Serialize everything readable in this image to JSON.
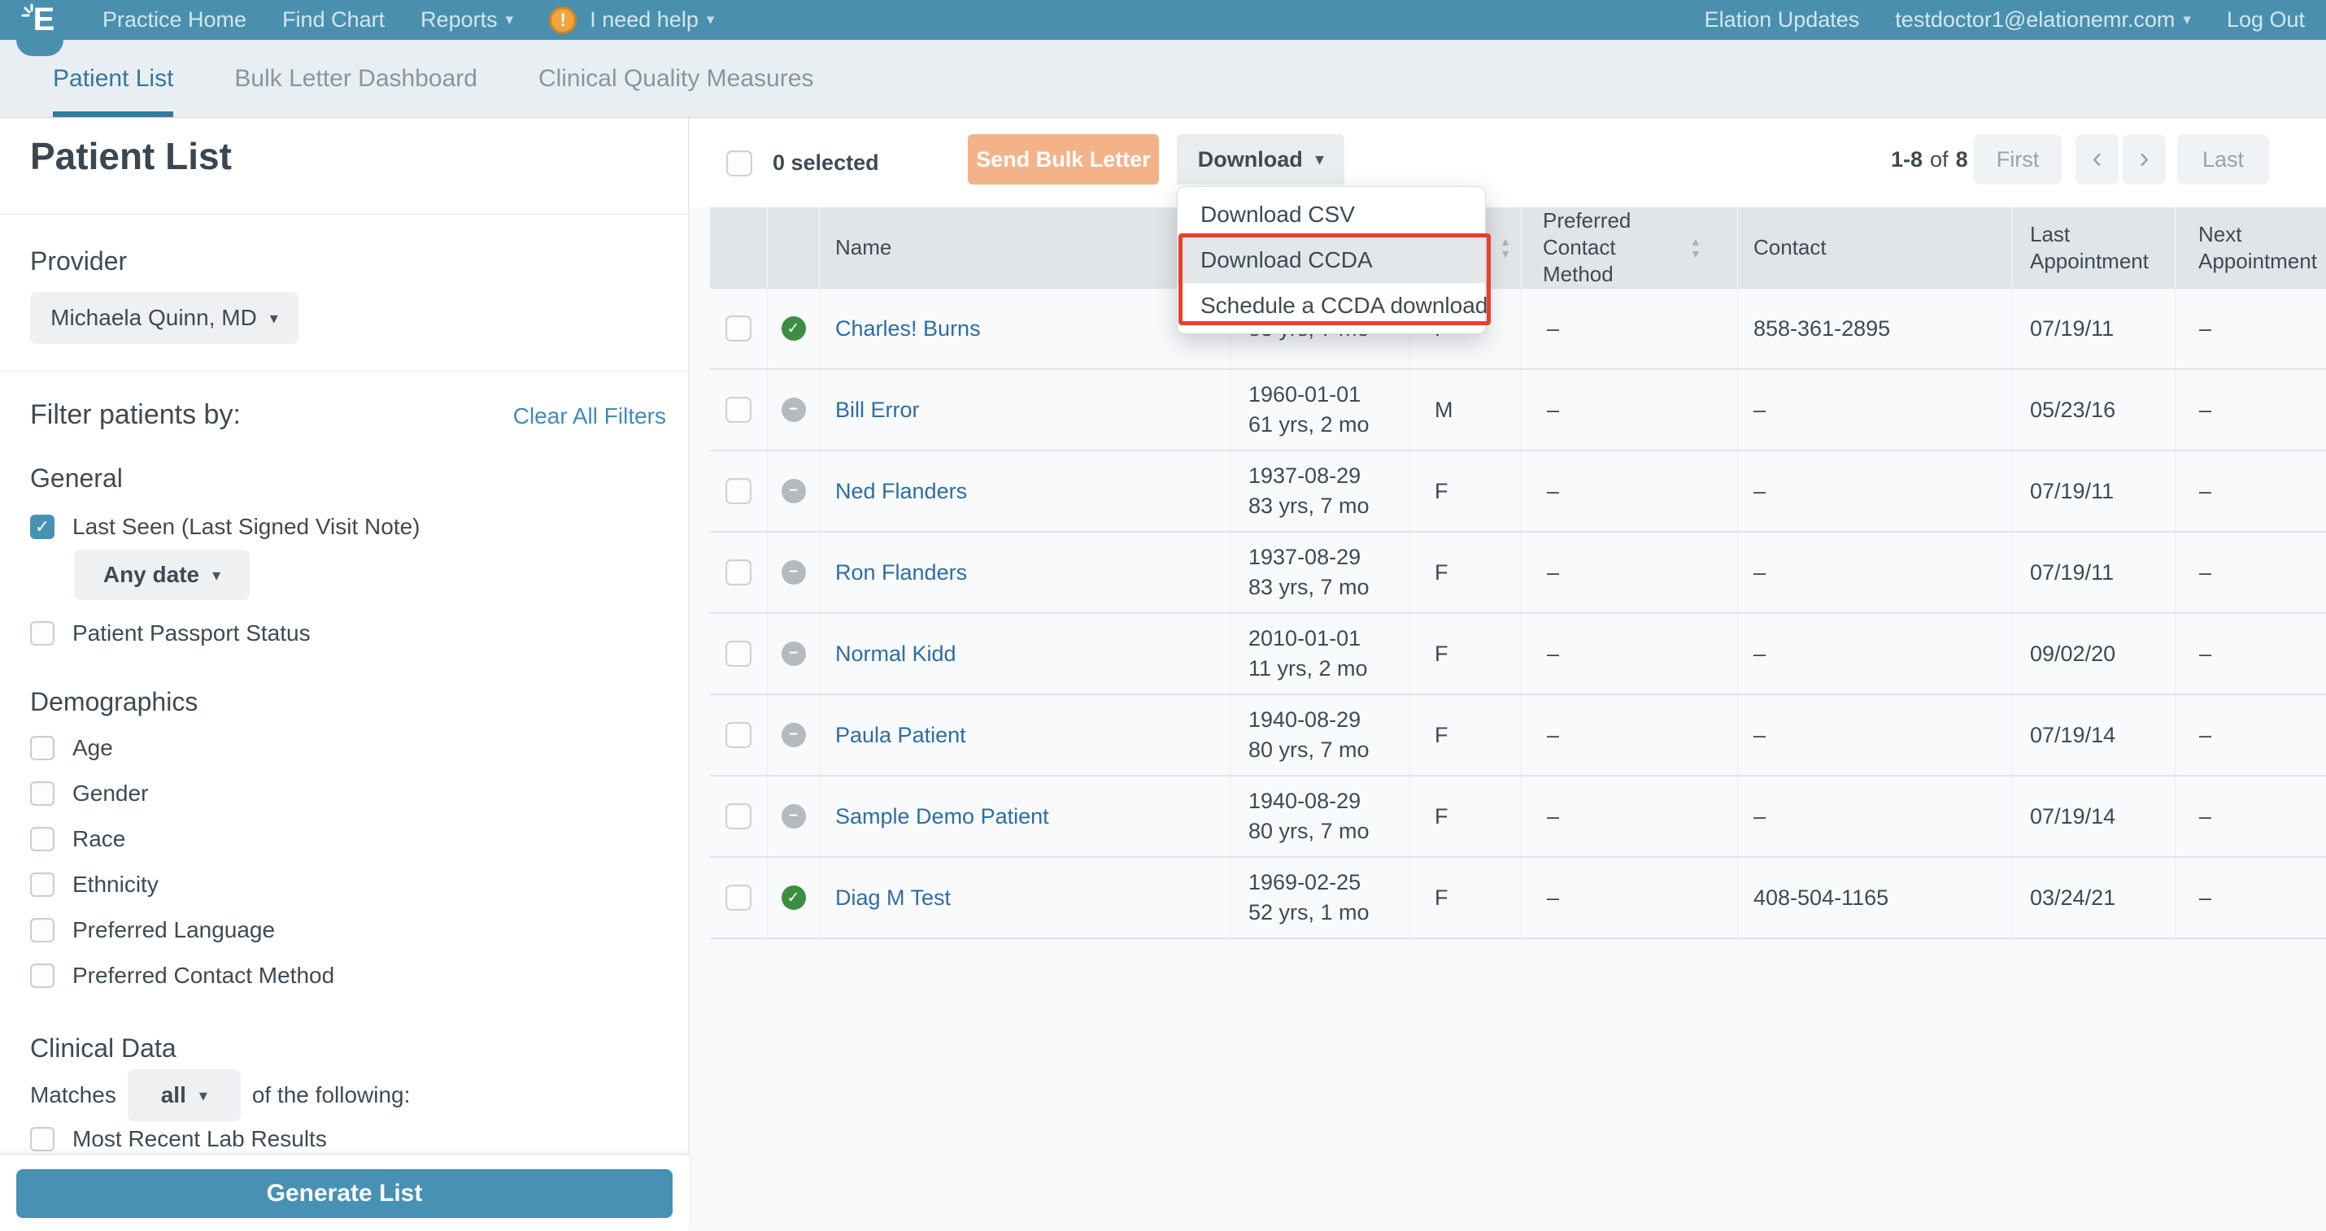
{
  "icons": {
    "caret": "▾",
    "check": "✓",
    "minus": "−",
    "sort_up": "▲",
    "sort_down": "▼",
    "prev": "‹",
    "next": "›",
    "exclamation": "!"
  },
  "nav": {
    "brand_letter": "E",
    "practice_home": "Practice Home",
    "find_chart": "Find Chart",
    "reports": "Reports",
    "help": "I need help",
    "elation_updates": "Elation Updates",
    "account_email": "testdoctor1@elationemr.com",
    "log_out": "Log Out"
  },
  "tabs": {
    "patient_list": "Patient List",
    "bulk_letter_dashboard": "Bulk Letter Dashboard",
    "clinical_quality_measures": "Clinical Quality Measures"
  },
  "sidebar": {
    "title": "Patient List",
    "provider_label": "Provider",
    "provider_value": "Michaela Quinn, MD",
    "filter_heading": "Filter patients by:",
    "clear_all_filters": "Clear All Filters",
    "general_heading": "General",
    "last_seen_label": "Last Seen (Last Signed Visit Note)",
    "last_seen_checked": true,
    "any_date_value": "Any date",
    "passport_label": "Patient Passport Status",
    "demographics_heading": "Demographics",
    "demographics_items": [
      "Age",
      "Gender",
      "Race",
      "Ethnicity",
      "Preferred Language",
      "Preferred Contact Method"
    ],
    "clinical_heading": "Clinical Data",
    "matches_label": "Matches",
    "matches_value": "all",
    "matches_suffix": "of the following:",
    "clipped_item": "Most Recent Lab Results",
    "generate_button": "Generate List"
  },
  "toolbar": {
    "selected_count": "0 selected",
    "send_bulk_letter": "Send Bulk Letter",
    "download_label": "Download",
    "menu": {
      "csv": "Download CSV",
      "ccda": "Download CCDA",
      "schedule": "Schedule a CCDA download"
    }
  },
  "pagination": {
    "range": "1-8",
    "of": "of",
    "total": "8",
    "first": "First",
    "last": "Last"
  },
  "table": {
    "headers": {
      "name": "Name",
      "dob": "",
      "sex": "",
      "preferred": "Preferred Contact Method",
      "contact": "Contact",
      "last": "Last Appointment",
      "next": "Next Appointment"
    },
    "rows": [
      {
        "status": "ok",
        "name": "Charles! Burns",
        "dob": "",
        "age": "83 yrs, 7 mo",
        "sex": "F",
        "pref": "–",
        "contact": "858-361-2895",
        "last": "07/19/11",
        "next": "–"
      },
      {
        "status": "none",
        "name": "Bill Error",
        "dob": "1960-01-01",
        "age": "61 yrs, 2 mo",
        "sex": "M",
        "pref": "–",
        "contact": "–",
        "last": "05/23/16",
        "next": "–"
      },
      {
        "status": "none",
        "name": "Ned Flanders",
        "dob": "1937-08-29",
        "age": "83 yrs, 7 mo",
        "sex": "F",
        "pref": "–",
        "contact": "–",
        "last": "07/19/11",
        "next": "–"
      },
      {
        "status": "none",
        "name": "Ron Flanders",
        "dob": "1937-08-29",
        "age": "83 yrs, 7 mo",
        "sex": "F",
        "pref": "–",
        "contact": "–",
        "last": "07/19/11",
        "next": "–"
      },
      {
        "status": "none",
        "name": "Normal Kidd",
        "dob": "2010-01-01",
        "age": "11 yrs, 2 mo",
        "sex": "F",
        "pref": "–",
        "contact": "–",
        "last": "09/02/20",
        "next": "–"
      },
      {
        "status": "none",
        "name": "Paula Patient",
        "dob": "1940-08-29",
        "age": "80 yrs, 7 mo",
        "sex": "F",
        "pref": "–",
        "contact": "–",
        "last": "07/19/14",
        "next": "–"
      },
      {
        "status": "none",
        "name": "Sample Demo Patient",
        "dob": "1940-08-29",
        "age": "80 yrs, 7 mo",
        "sex": "F",
        "pref": "–",
        "contact": "–",
        "last": "07/19/14",
        "next": "–"
      },
      {
        "status": "ok",
        "name": "Diag M Test",
        "dob": "1969-02-25",
        "age": "52 yrs, 1 mo",
        "sex": "F",
        "pref": "–",
        "contact": "408-504-1165",
        "last": "03/24/21",
        "next": "–"
      }
    ]
  },
  "annotation": {
    "color": "#e8402c"
  }
}
